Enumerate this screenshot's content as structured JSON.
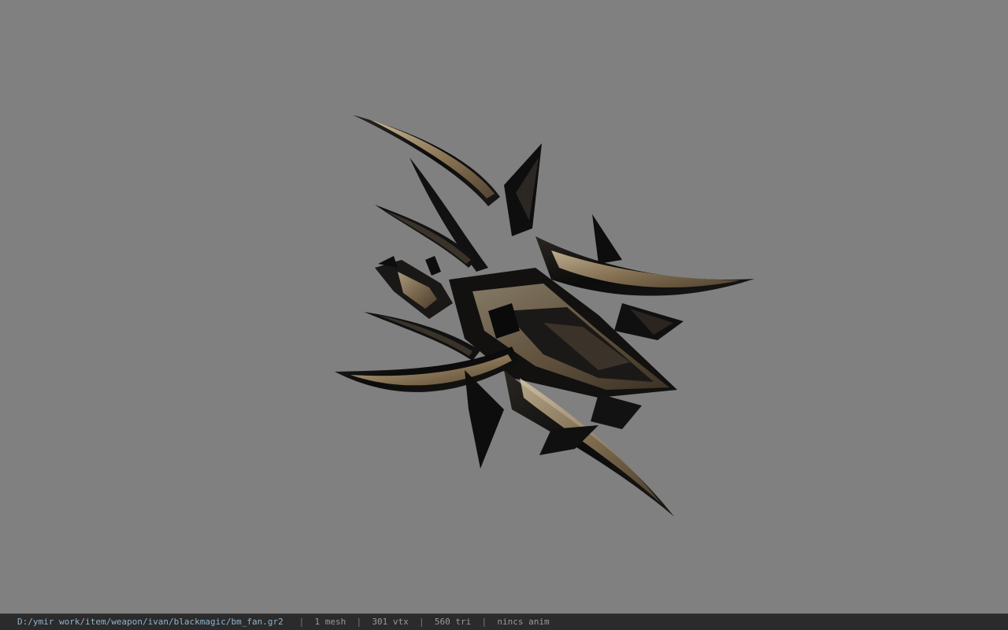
{
  "viewport": {
    "background": "#808080",
    "model_palette": {
      "dark": "#0d0d0d",
      "mid": "#1c1a18",
      "gold": "#a89170",
      "gold_light": "#d8c4a0"
    }
  },
  "status_bar": {
    "file_path": "D:/ymir work/item/weapon/ivan/blackmagic/bm_fan.gr2",
    "separator": "|",
    "mesh_count": "1 mesh",
    "vertex_count": "301 vtx",
    "triangle_count": "560 tri",
    "anim_status": "nincs anim"
  }
}
